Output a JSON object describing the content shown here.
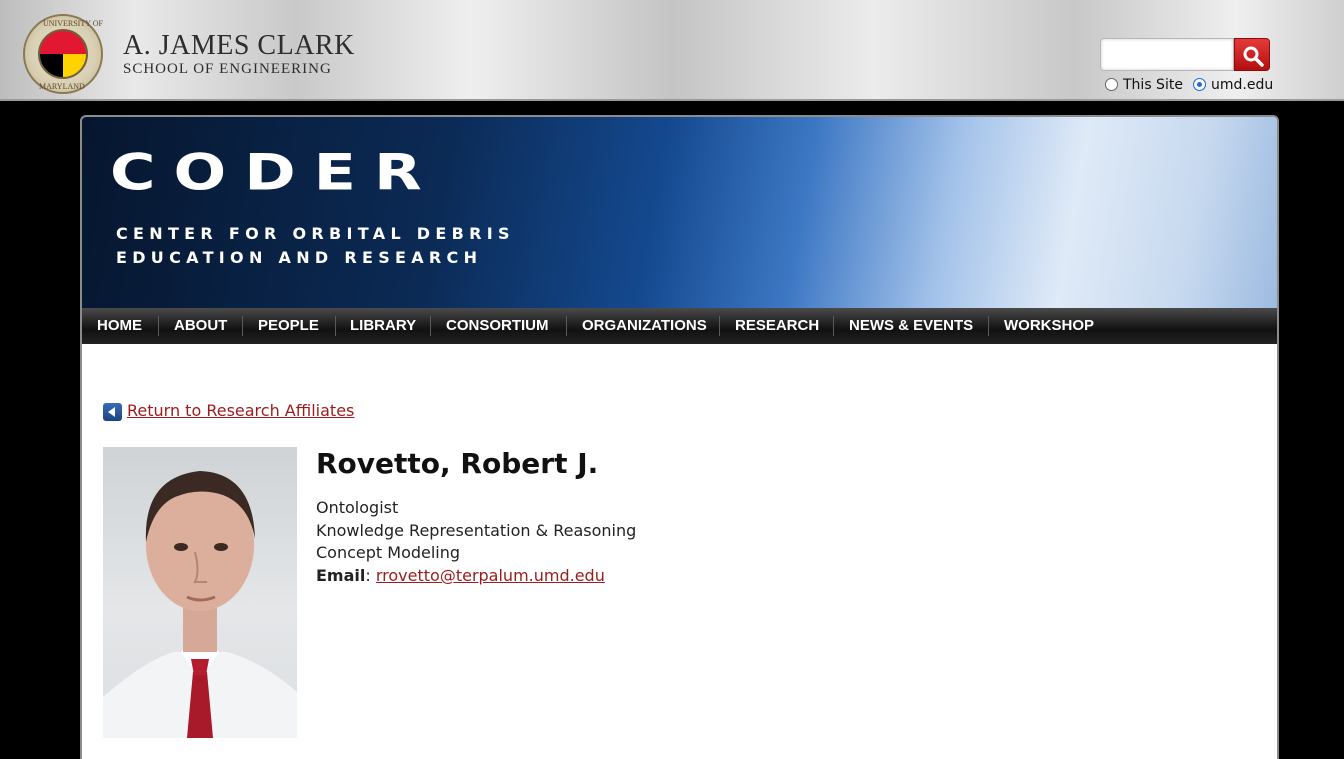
{
  "header": {
    "seal_text_top": "UNIVERSITY OF",
    "seal_text_bottom": "MARYLAND",
    "brand_line1": "A. JAMES CLARK",
    "brand_line2": "SCHOOL OF ENGINEERING",
    "search": {
      "value": "",
      "placeholder": ""
    },
    "scope_options": [
      {
        "label": "This Site",
        "selected": false
      },
      {
        "label": "umd.edu",
        "selected": true
      }
    ]
  },
  "banner": {
    "title": "CODER",
    "subtitle_line1": "CENTER FOR ORBITAL DEBRIS",
    "subtitle_line2": "EDUCATION AND RESEARCH"
  },
  "nav": {
    "items": [
      {
        "label": "HOME"
      },
      {
        "label": "ABOUT"
      },
      {
        "label": "PEOPLE"
      },
      {
        "label": "LIBRARY"
      },
      {
        "label": "CONSORTIUM"
      },
      {
        "label": "ORGANIZATIONS"
      },
      {
        "label": "RESEARCH"
      },
      {
        "label": "NEWS & EVENTS"
      },
      {
        "label": "WORKSHOP"
      }
    ]
  },
  "content": {
    "back_link": "Return to Research Affiliates",
    "name": "Rovetto, Robert J.",
    "details": [
      "Ontologist",
      "Knowledge Representation & Reasoning",
      "Concept Modeling"
    ],
    "email_label": "Email",
    "email_separator": ": ",
    "email": "rrovetto@terpalum.umd.edu"
  },
  "colors": {
    "link": "#9c1c1c",
    "search_button": "#c81818",
    "nav_bg": "#1a1a1a"
  }
}
